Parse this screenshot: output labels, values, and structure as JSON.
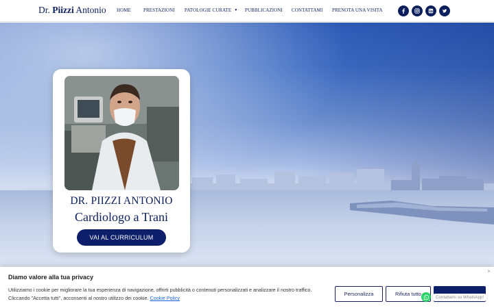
{
  "header": {
    "logo": {
      "prefix": "Dr. ",
      "name": "Piizzi",
      "suffix": " Antonio"
    },
    "nav": [
      {
        "label": "HOME"
      },
      {
        "label": "PRESTAZIONI"
      },
      {
        "label": "PATOLOGIE CURATE",
        "has_dropdown": true
      },
      {
        "label": "PUBBLICAZIONI"
      },
      {
        "label": "CONTATTAMI"
      },
      {
        "label": "PRENOTA UNA VISITA"
      }
    ],
    "socials": [
      {
        "icon": "facebook-icon"
      },
      {
        "icon": "instagram-icon"
      },
      {
        "icon": "linkedin-icon"
      },
      {
        "icon": "twitter-icon"
      }
    ]
  },
  "hero": {
    "name": "DR. PIIZZI ANTONIO",
    "role": "Cardiologo a Trani",
    "cta": "VAI AL CURRICULUM"
  },
  "cookie": {
    "title": "Diamo valore alla tua privacy",
    "text": "Utilizziamo i cookie per migliorare la tua esperienza di navigazione, offrirti pubblicità o contenuti personalizzati e analizzare il nostro traffico. Cliccando \"Accetta tutti\", acconsenti al nostro utilizzo dei cookie.",
    "policy_link": "Cookie Policy",
    "buttons": {
      "customize": "Personalizza",
      "reject": "Rifiuta tutto",
      "accept": ""
    },
    "close": "×"
  },
  "whatsapp": {
    "label": "Contattami su WhatsApp!"
  },
  "colors": {
    "brand_navy": "#0b1f5c",
    "button_navy": "#0d1f6b",
    "link_blue": "#1863dc",
    "whatsapp_green": "#25d366"
  }
}
